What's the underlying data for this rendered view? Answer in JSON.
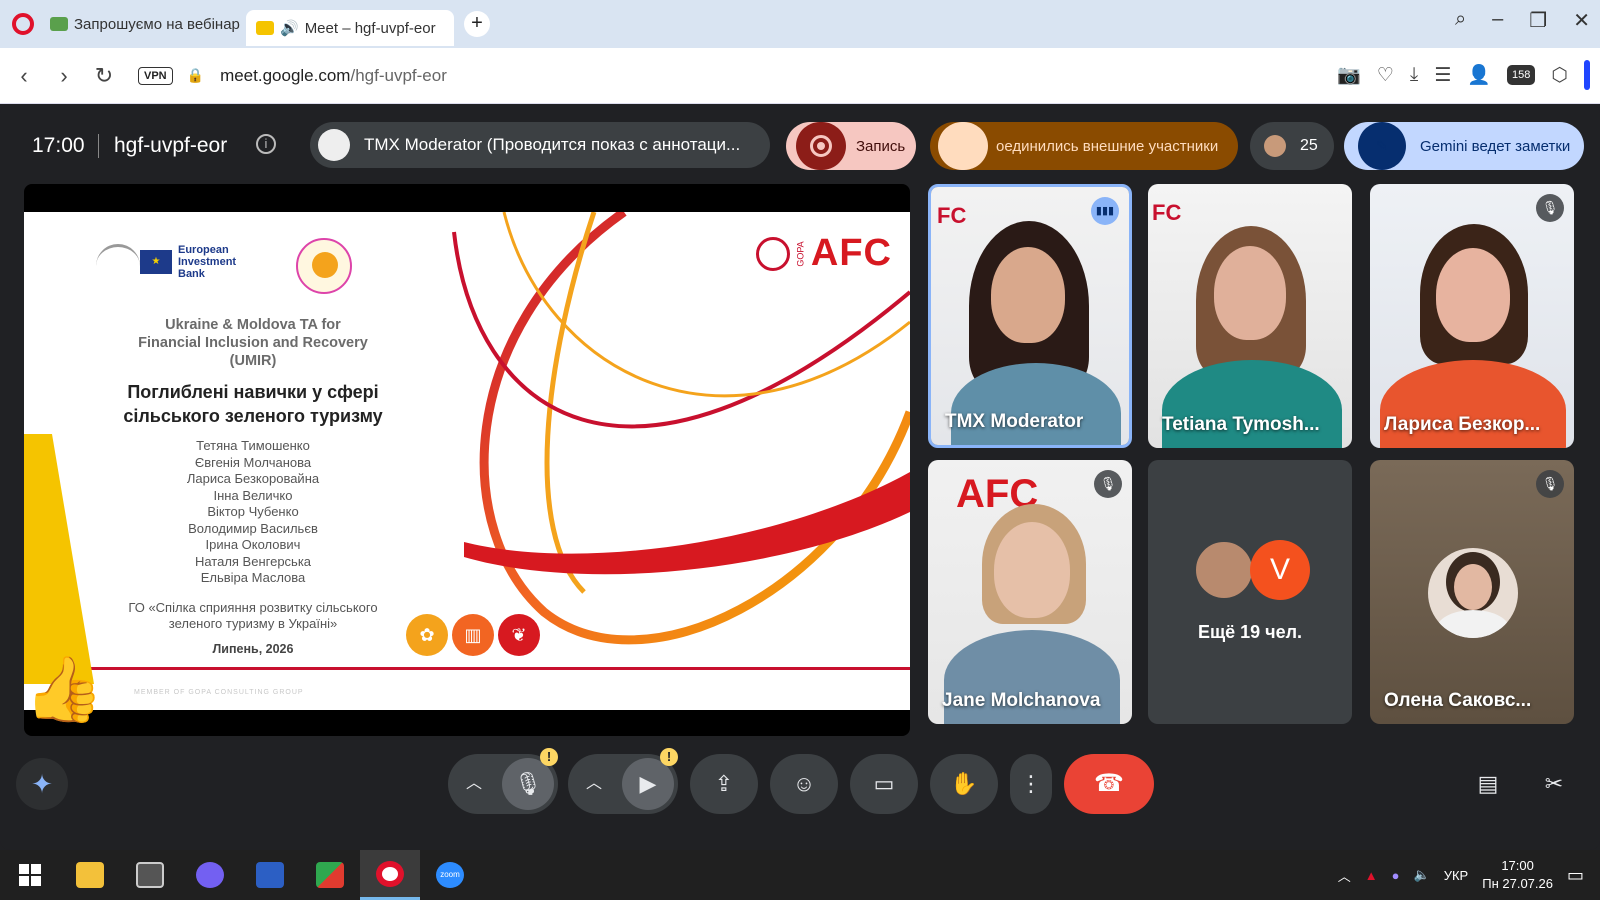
{
  "browser": {
    "tabs": [
      {
        "label": "Запрошуємо на вебінар",
        "active": false
      },
      {
        "label": "Meet – hgf-uvpf-eor",
        "active": true
      }
    ],
    "new_tab": "+",
    "url_host": "meet.google.com",
    "url_path": "/hgf-uvpf-eor",
    "vpn_label": "VPN",
    "badge_count": "158"
  },
  "meet": {
    "time": "17:00",
    "meeting_code": "hgf-uvpf-eor",
    "presenting_label": "TMX Moderator (Проводится показ с аннотаци...",
    "recording_label": "Запись",
    "external_label": "оединились внешние участники",
    "participants_count": "25",
    "gemini_label": "Gemini ведет заметки"
  },
  "slide": {
    "eib_name": "European Investment Bank",
    "afc_logo": "AFC",
    "gopa": "GOPA",
    "subtitle_lines": [
      "Ukraine & Moldova TA for",
      "Financial Inclusion and Recovery",
      "(UMIR)"
    ],
    "title_lines": [
      "Поглиблені навички у сфері",
      "сільського зеленого туризму"
    ],
    "authors": [
      "Тетяна Тимошенко",
      "Євгенія Молчанова",
      "Лариса Безкоровайна",
      "Інна Величко",
      "Віктор Чубенко",
      "Володимир Васильєв",
      "Ірина Околович",
      "Наталя Венгерська",
      "Ельвіра Маслова"
    ],
    "org_lines": [
      "ГО «Спілка сприяння розвитку сільського",
      "зеленого туризму в Україні»"
    ],
    "date": "Липень, 2026",
    "footer": "MEMBER OF GOPA CONSULTING GROUP"
  },
  "tiles": [
    {
      "name": "TMX Moderator",
      "speaking": true
    },
    {
      "name": "Tetiana Tymosh...",
      "speaking": false
    },
    {
      "name": "Лариса Безкор...",
      "muted": true
    },
    {
      "name": "Jane Molchanova",
      "muted": true
    },
    {
      "more_label": "Ещё 19 чел.",
      "avatar_letter": "V"
    },
    {
      "name": "Олена Саковс...",
      "muted": true
    }
  ],
  "controls": {
    "warn_mark": "!"
  },
  "taskbar": {
    "zoom_label": "zoom",
    "lang": "УКР",
    "time": "17:00",
    "date": "Пн 27.07.26"
  },
  "colors": {
    "meet_bg": "#202124",
    "hangup": "#ea4335",
    "accent_blue": "#8ab4f8",
    "slide_red": "#c8102e",
    "slide_orange": "#f4a31c"
  }
}
